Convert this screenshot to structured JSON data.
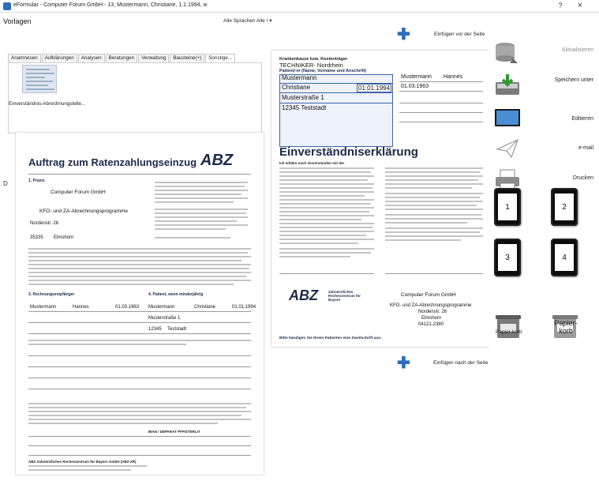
{
  "window": {
    "title": "eFormular - Computer Forum GmbH - 13, Mustermann, Christiane, 1.1.1994, w",
    "help": "?",
    "close": "×"
  },
  "left_panel": {
    "vorlagen_label": "Vorlagen",
    "language_select": "Alle Sprachen Alle !",
    "tabs": [
      "Anamnesen",
      "Aufklärungen",
      "Analysen",
      "Beratungen",
      "Verwaltung",
      "Bausteine(+)",
      "Sonstige..."
    ],
    "active_tab": 6,
    "template_caption": "Einverständnis-Abrechnungstelle...",
    "stray_char": "D"
  },
  "insert": {
    "before_label": "Einfügen vor der Seite",
    "after_label": "Einfügen nach der Seite"
  },
  "left_doc": {
    "title": "Auftrag zum Ratenzahlungseinzug",
    "logo": "ABZ",
    "company": "Computer Forum GmbH",
    "program": "KFO- und ZA-Abrechnungsprogramme",
    "street": "Nordenstr. 26",
    "zip": "35335",
    "city": "Elmshorn",
    "section3_label": "3. Rechnungsempfänger",
    "section4_label": "4. Patient, wenn minderjährig",
    "patient_lastname": "Mustermann",
    "patient_firstname": "Christiane",
    "patient_dob": "01.01.1994",
    "payer_lastname": "Mustermann",
    "payer_firstname": "Hannes",
    "payer_dob": "01.03.1963",
    "address_street": "Musterstraße 1",
    "address_zip": "12345",
    "address_city": "Teststadt",
    "iban_label": "IBAN / DEPARAT PFFISTERLIT",
    "footer_company": "ABZ Zahnärztliches Rechenzentrum für Bayern GmbH (ABZ-ZR)"
  },
  "right_doc": {
    "insurance_label": "Krankenkasse bzw. Kostenträger",
    "insurance_name": "TECHNIKER- Nordrhein",
    "patient_label": "Patient/-in (Name, Vorname und Anschrift)",
    "lastname": "Mustermann",
    "firstname": "Christiane",
    "dob": "01.01.1994",
    "street": "Musterstraße 1",
    "zip_city": "12345   Teststadt",
    "payer_lastname": "Mustermann",
    "payer_firstname": "Hannes",
    "payer_dob": "01.03.1963",
    "title": "Einverständniserklärung",
    "intro": "Ich erkläre mich einverstanden mit der",
    "logo": "ABZ",
    "logo_sub": "Zahnärztliches Rechenzentrum für Bayern",
    "practice_name": "Computer Forum GmbH",
    "practice_program": "KFO- und ZA-Abrechnungsprogramme",
    "practice_street": "Nordenstr. 26",
    "practice_city": "Elmshorn",
    "practice_phone": "04121-2380",
    "footer": "Bitte händigen Sie Ihrem Patienten eine Zweitschrift aus."
  },
  "commands": {
    "aktualisieren": "Aktualisieren",
    "speichern": "Speichern unter",
    "editieren": "Editieren",
    "email": "e-mail",
    "drucken": "Drucken",
    "layout_buttons": [
      "1",
      "2",
      "3",
      "4"
    ],
    "papierkorb_left": "Papier-korb",
    "papierkorb_right": "Papier-korb"
  },
  "colors": {
    "accent": "#2e6dbd",
    "abz_navy": "#1b2a4a",
    "form_field_bg": "#eef2fa"
  }
}
